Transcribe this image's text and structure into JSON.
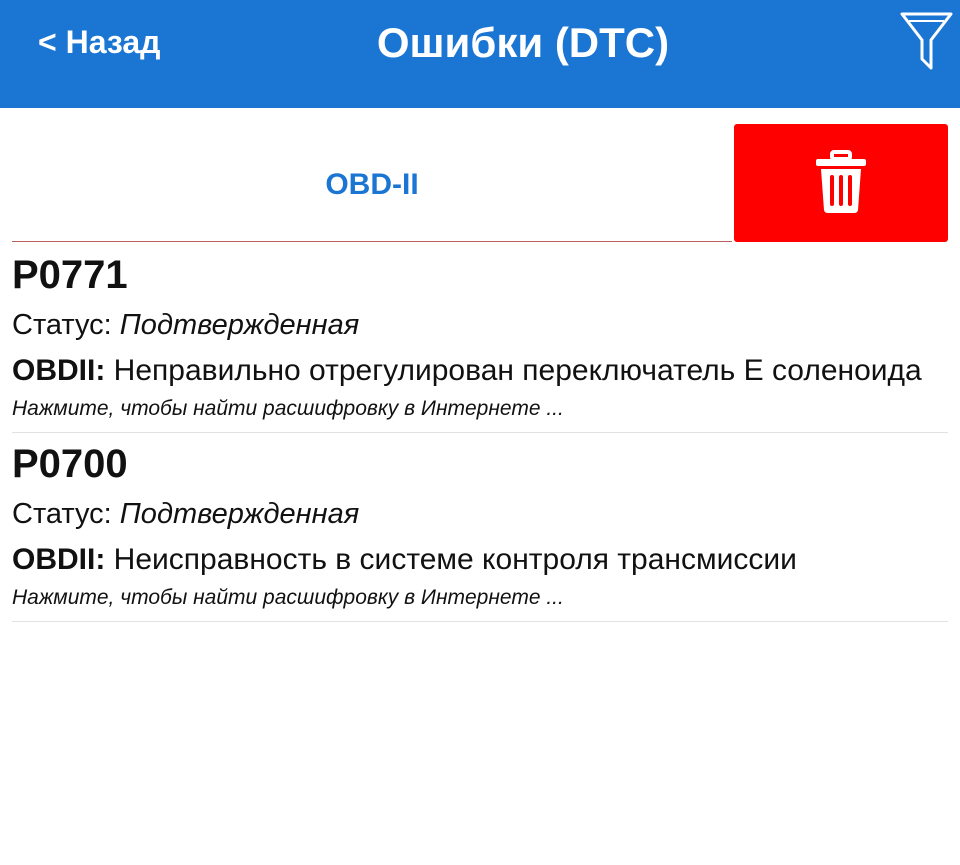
{
  "header": {
    "back_label": "< Назад",
    "title": "Ошибки (DTC)",
    "filter_icon": "filter-funnel-icon"
  },
  "tabs": {
    "obd_label": "OBD-II",
    "delete_icon": "trash-icon"
  },
  "dtc_items": [
    {
      "code": "P0771",
      "status_label": "Статус:",
      "status_value": "Подтвержденная",
      "desc_label": "OBDII:",
      "desc_text": "Неправильно отрегулирован переключатель E соленоида",
      "hint": "Нажмите, чтобы найти расшифровку в Интернете ..."
    },
    {
      "code": "P0700",
      "status_label": "Статус:",
      "status_value": "Подтвержденная",
      "desc_label": "OBDII:",
      "desc_text": "Неисправность в системе контроля трансмиссии",
      "hint": "Нажмите, чтобы найти расшифровку в Интернете ..."
    }
  ],
  "colors": {
    "header_bg": "#1b76d3",
    "accent": "#1b76d3",
    "delete_bg": "#ff0000"
  }
}
